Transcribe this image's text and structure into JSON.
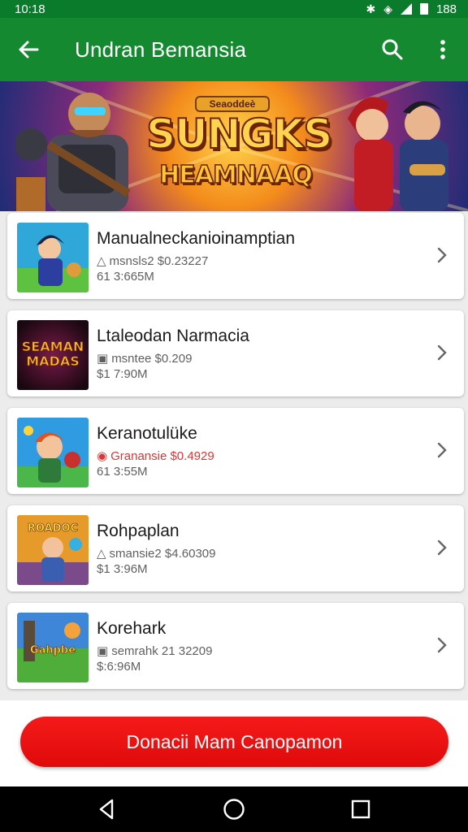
{
  "status_bar": {
    "time": "10:18",
    "battery": "188"
  },
  "app_bar": {
    "title": "Undran Bemansia"
  },
  "banner": {
    "subtitle": "Seaoddeè",
    "title_line1": "SUNGKS",
    "title_line2": "HEAMNAAQ"
  },
  "items": [
    {
      "name": "Manualneckanioinamptian",
      "meta": "msnsls2 $0.23227",
      "size": "61 3:665M",
      "meta_red": false,
      "thumb_text": ""
    },
    {
      "name": "Ltaleodan Narmacia",
      "meta": "msntee $0.209",
      "size": "$1 7:90M",
      "meta_red": false,
      "thumb_text": "SEAMAN MADAS"
    },
    {
      "name": "Keranotulüke",
      "meta": "Granansie $0.4929",
      "size": "61 3:55M",
      "meta_red": true,
      "thumb_text": ""
    },
    {
      "name": "Rohpaplan",
      "meta": "smansie2 $4.60309",
      "size": "$1 3:96M",
      "meta_red": false,
      "thumb_text": "ROADOC"
    },
    {
      "name": "Korehark",
      "meta": "semrahk 21 32209",
      "size": "$:6:96M",
      "meta_red": false,
      "thumb_text": "Gahpbe"
    }
  ],
  "cta": {
    "label": "Donacii Mam Canopamon"
  },
  "colors": {
    "app_bar": "#14892f",
    "status_bar": "#0a7a2b",
    "cta": "#ec1111",
    "meta_red": "#d93636"
  }
}
